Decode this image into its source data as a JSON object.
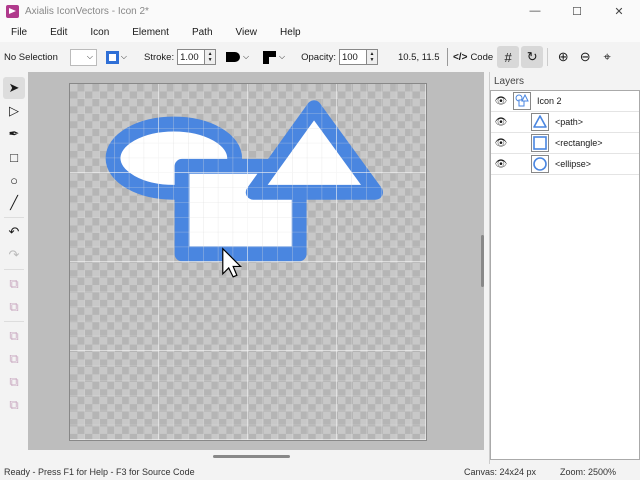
{
  "window": {
    "title": "Axialis IconVectors - Icon 2*",
    "minimize": "—",
    "maximize": "☐",
    "close": "✕"
  },
  "menu": [
    "File",
    "Edit",
    "Icon",
    "Element",
    "Path",
    "View",
    "Help"
  ],
  "toolbar": {
    "selection": "No Selection",
    "stroke_label": "Stroke:",
    "stroke_value": "1.00",
    "opacity_label": "Opacity:",
    "opacity_value": "100",
    "coords": "10.5, 11.5",
    "code_label": "Code"
  },
  "layers": {
    "title": "Layers",
    "items": [
      {
        "label": "Icon 2",
        "indent": 0,
        "shape": "group"
      },
      {
        "label": "<path>",
        "indent": 1,
        "shape": "triangle"
      },
      {
        "label": "<rectangle>",
        "indent": 1,
        "shape": "rectangle"
      },
      {
        "label": "<ellipse>",
        "indent": 1,
        "shape": "ellipse"
      }
    ]
  },
  "canvas": {
    "accent": "#4a86e0"
  },
  "status": {
    "left": "Ready - Press F1 for Help - F3 for Source Code",
    "canvas": "Canvas: 24x24 px",
    "zoom": "Zoom: 2500%"
  }
}
